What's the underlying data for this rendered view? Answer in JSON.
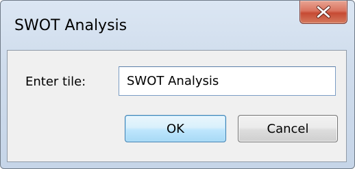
{
  "window": {
    "title": "SWOT Analysis"
  },
  "form": {
    "label": "Enter tile:",
    "input_value": "SWOT Analysis"
  },
  "buttons": {
    "ok_label": "OK",
    "cancel_label": "Cancel"
  },
  "icons": {
    "close": "close-icon"
  },
  "colors": {
    "close_button": "#c64a33",
    "ok_border": "#3c7fb1",
    "dialog_background": "#f0f0f0",
    "frame": "#cfdcec"
  }
}
